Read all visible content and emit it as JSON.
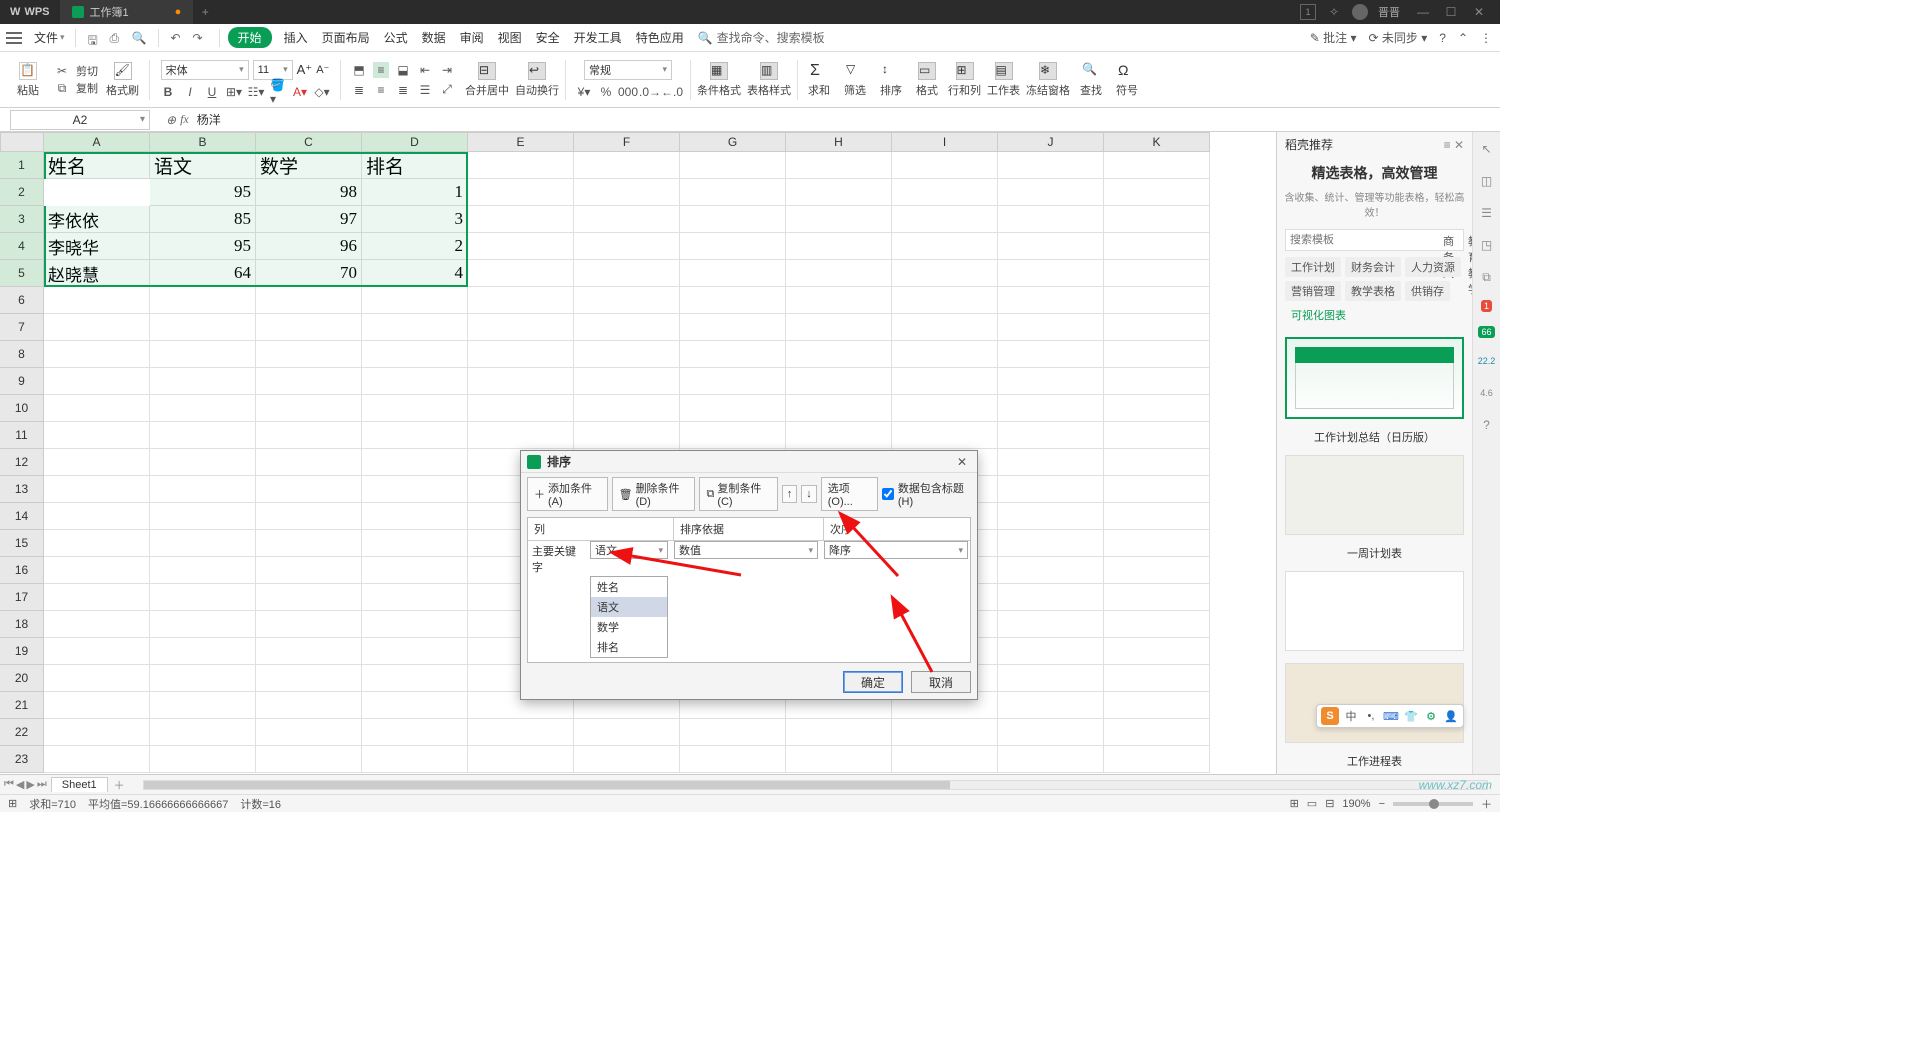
{
  "titlebar": {
    "app": "WPS",
    "workbook": "工作簿1",
    "add": "+",
    "user": "晋晋",
    "badge": "1"
  },
  "menu": {
    "file": "文件",
    "start": "开始",
    "items": [
      "插入",
      "页面布局",
      "公式",
      "数据",
      "审阅",
      "视图",
      "安全",
      "开发工具",
      "特色应用"
    ],
    "search_prompt": "查找命令、搜索模板",
    "annotate": "批注",
    "unsync": "未同步"
  },
  "toolbar": {
    "paste": "粘贴",
    "cut": "剪切",
    "copy": "复制",
    "fmtpaint": "格式刷",
    "font_name": "宋体",
    "font_size": "11",
    "merge": "合并居中",
    "wrap": "自动换行",
    "numfmt": "常规",
    "condfmt": "条件格式",
    "tblstyle": "表格样式",
    "sum": "求和",
    "filter": "筛选",
    "sort": "排序",
    "format": "格式",
    "rowcol": "行和列",
    "worksheet": "工作表",
    "freeze": "冻结窗格",
    "find": "查找",
    "symbol": "符号"
  },
  "namebox": "A2",
  "formula_val": "杨洋",
  "columns": [
    "A",
    "B",
    "C",
    "D",
    "E",
    "F",
    "G",
    "H",
    "I",
    "J",
    "K"
  ],
  "headers": [
    "姓名",
    "语文",
    "数学",
    "排名"
  ],
  "rows": [
    {
      "name": "杨洋",
      "yw": 95,
      "sx": 98,
      "rk": 1
    },
    {
      "name": "李依依",
      "yw": 85,
      "sx": 97,
      "rk": 3
    },
    {
      "name": "李晓华",
      "yw": 95,
      "sx": 96,
      "rk": 2
    },
    {
      "name": "赵晓慧",
      "yw": 64,
      "sx": 70,
      "rk": 4
    }
  ],
  "sort_dialog": {
    "title": "排序",
    "add_cond": "添加条件(A)",
    "del_cond": "删除条件(D)",
    "copy_cond": "复制条件(C)",
    "options": "选项(O)...",
    "has_header": "数据包含标题(H)",
    "col_h": "列",
    "basis_h": "排序依据",
    "order_h": "次序",
    "keylabel": "主要关键字",
    "key_sel": "语文",
    "basis_sel": "数值",
    "order_sel": "降序",
    "dd": [
      "姓名",
      "语文",
      "数学",
      "排名"
    ],
    "ok": "确定",
    "cancel": "取消"
  },
  "right_panel": {
    "head": "稻壳推荐",
    "title": "精选表格，高效管理",
    "sub": "含收集、统计、管理等功能表格，轻松高效！",
    "search_ph": "搜索模板",
    "tabs": [
      "商务风",
      "教育教学"
    ],
    "cats": [
      "工作计划",
      "财务会计",
      "人力资源",
      "营销管理",
      "教学表格",
      "供销存",
      "可视化图表"
    ],
    "tpl1": "",
    "tpl2": "工作计划总结（日历版）",
    "tpl3": "一周计划表",
    "tpl4": "工作进程表"
  },
  "sidebar_badges": {
    "red": "1",
    "green": "66",
    "teal": "22.2",
    "speed": "4.6"
  },
  "sheet_tab": "Sheet1",
  "status": {
    "sum": "求和=710",
    "avg": "平均值=59.16666666666667",
    "count": "计数=16",
    "zoom": "190%"
  },
  "watermark": "www.xz7.com",
  "ime_cn": "中"
}
